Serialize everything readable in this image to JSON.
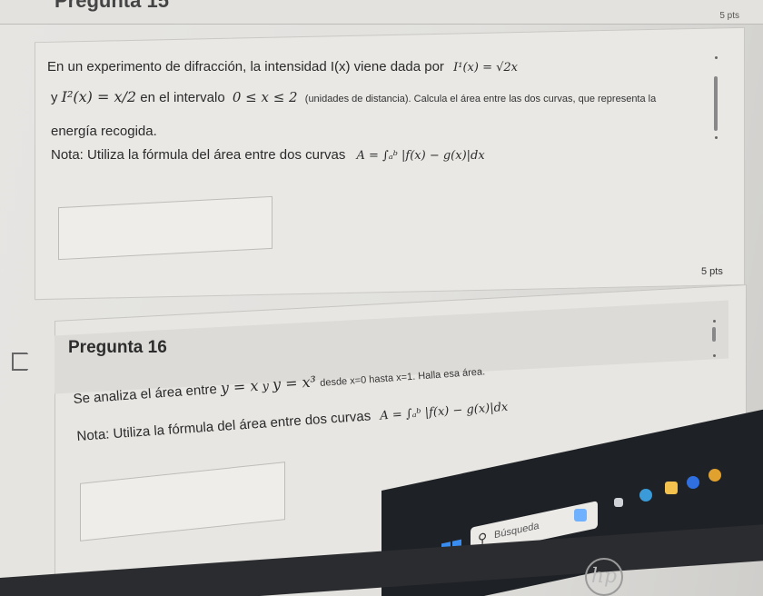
{
  "prev_question": {
    "header_fragment": "Pregunta 15",
    "points": "5 pts"
  },
  "question15": {
    "line1": "En un experimento de difracción, la intensidad I(x) viene dada por",
    "line1_math": "I¹(x) = √2x",
    "line2_pre": "y",
    "line2_math": "I²(x) = x/2",
    "line2_mid": "en el intervalo",
    "line2_interval": "0 ≤ x ≤ 2",
    "line2_post": "(unidades de distancia). Calcula el área entre las dos curvas, que representa la",
    "line3": "energía recogida.",
    "note": "Nota: Utiliza la fórmula del área entre dos curvas",
    "note_math": "A = ∫ₐᵇ |f(x) − g(x)|dx"
  },
  "question16": {
    "points": "5 pts",
    "title": "Pregunta 16",
    "line1_pre": "Se analiza el área entre",
    "line1_math1": "y = x",
    "line1_y": "y",
    "line1_math2": "y = x³",
    "line1_post": "desde x=0 hasta x=1. Halla esa área.",
    "note": "Nota: Utiliza la fórmula del área entre dos curvas",
    "note_math": "A = ∫ₐᵇ |f(x) − g(x)|dx"
  },
  "taskbar": {
    "search_placeholder": "Búsqueda",
    "brand": "hp"
  }
}
